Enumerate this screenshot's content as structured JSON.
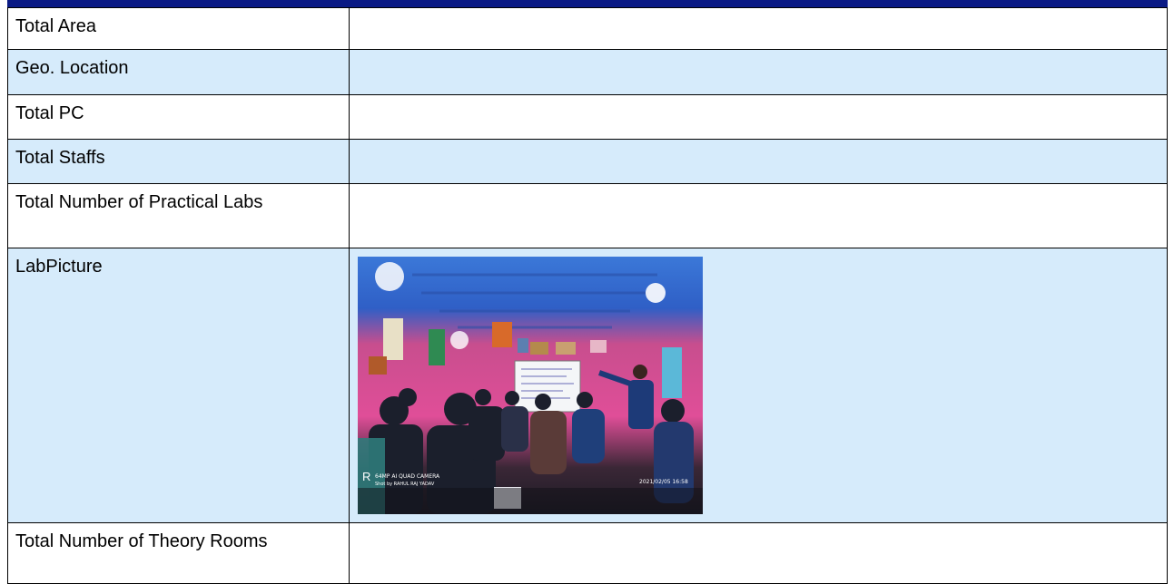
{
  "rows": [
    {
      "label": "Total Area",
      "value": ""
    },
    {
      "label": "Geo. Location",
      "value": ""
    },
    {
      "label": "Total PC",
      "value": ""
    },
    {
      "label": "Total Staffs",
      "value": ""
    },
    {
      "label": "Total Number of Practical Labs",
      "value": ""
    },
    {
      "label": "LabPicture",
      "value": ""
    },
    {
      "label": "Total Number of Theory Rooms",
      "value": ""
    }
  ],
  "photo": {
    "subject": "classroom-lab-photo",
    "watermark_line1": "64MP AI QUAD CAMERA",
    "watermark_line2": "Shot by RAHUL RAJ YADAV",
    "timestamp": "2021/02/05 16:58"
  },
  "colors": {
    "header_bar": "#0a1a85",
    "alt_row": "#d6ebfb",
    "border": "#000000"
  }
}
